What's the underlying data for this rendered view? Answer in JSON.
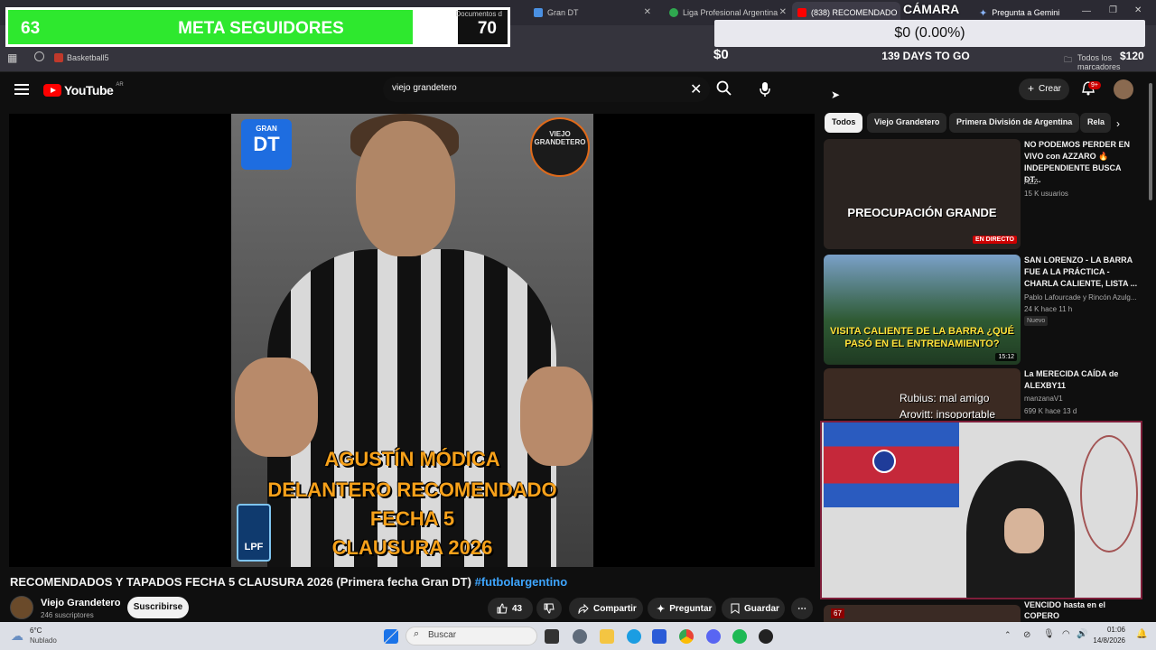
{
  "browser": {
    "tabs": [
      {
        "label": "Documentos d",
        "active": false
      },
      {
        "label": "Gran DT",
        "active": false
      },
      {
        "label": "Liga Profesional Argentina",
        "active": false
      },
      {
        "label": "(838) RECOMENDADO",
        "active": true
      }
    ],
    "gemini_label": "Pregunta a Gemini",
    "bookmark": "Basketball5",
    "all_bookmarks": "Todos los marcadores"
  },
  "overlays": {
    "goal": {
      "current": "63",
      "label": "META SEGUIDORES",
      "target": "70",
      "progress": 0.9
    },
    "camera_label": "CÁMARA",
    "donation_amount": "$0 (0.00%)",
    "donation_raised": "$0",
    "donation_goal": "$120",
    "days_left": "139 DAYS TO GO"
  },
  "header": {
    "logo_text": "YouTube",
    "region": "AR",
    "search_value": "viejo grandetero",
    "create_label": "Crear",
    "notifications_badge": "9+"
  },
  "video": {
    "thumb_text": [
      "AGUSTÍN MÓDICA",
      "DELANTERO RECOMENDADO",
      "FECHA 5",
      "CLAUSURA 2026"
    ],
    "gdt_logo_small": "GRAN",
    "gdt_logo_big": "DT",
    "vg_badge": "VIEJO GRANDETERO",
    "lpf_badge": "LPF",
    "title": "RECOMENDADOS Y TAPADOS FECHA 5 CLAUSURA 2026 (Primera fecha Gran DT)",
    "hashtag": "#futbolargentino",
    "channel": "Viejo Grandetero",
    "subscribers": "246 suscriptores",
    "subscribe_label": "Suscribirse",
    "likes": "43",
    "share_label": "Compartir",
    "ask_label": "Preguntar",
    "save_label": "Guardar"
  },
  "chips": [
    "Todos",
    "Viejo Grandetero",
    "Primera División de Argentina",
    "Rela"
  ],
  "recommendations": [
    {
      "title": "NO PODEMOS PERDER EN VIVO con AZZARO 🔥 INDEPENDIENTE BUSCA DT...",
      "channel": "AZZ",
      "meta": "15 K usuarios",
      "thumb_text": "PREOCUPACIÓN GRANDE",
      "live_label": "EN DIRECTO",
      "thumb_color": "#2a2320",
      "badge": ""
    },
    {
      "title": "SAN LORENZO - LA BARRA FUE A LA PRÁCTICA - CHARLA CALIENTE, LISTA ...",
      "channel": "Pablo Lafourcade y Rincón Azulg...",
      "meta": "24 K  hace 11 h",
      "thumb_text": "VISITA CALIENTE DE LA BARRA ¿QUÉ PASÓ EN EL ENTRENAMIENTO?",
      "duration": "15:12",
      "thumb_color": "#2e5a33",
      "badge": "Nuevo"
    },
    {
      "title": "La MERECIDA CAÍDA de ALEXBY11",
      "channel": "manzanaV1",
      "meta": "699 K  hace 13 d",
      "thumb_text": "Rubius: mal amigo",
      "thumb_text2": "Arovitt: insoportable",
      "thumb_color": "#3b2a22",
      "badge": ""
    }
  ],
  "partial_next_title": "VENCIDO hasta en el COPERO",
  "partial_next_badge": "67",
  "taskbar": {
    "weather_temp": "6°C",
    "weather_desc": "Nublado",
    "search_label": "Buscar",
    "time": "01:06",
    "date": "14/8/2026"
  },
  "colors": {
    "goal_fill": "#2ee82e",
    "yt_red": "#ff0000",
    "accent_blue": "#3ea6ff"
  }
}
